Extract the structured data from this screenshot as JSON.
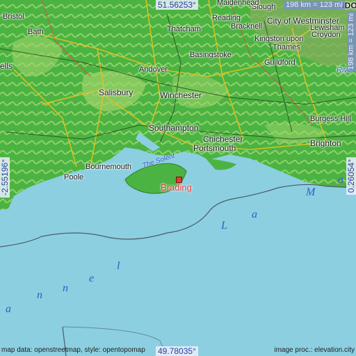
{
  "map": {
    "highlight_place": "Brading",
    "colors": {
      "sea": "#8ccfe0",
      "land_low": "#3fae3a",
      "land_high": "#9fd36a",
      "highlight": "#e23b3b",
      "coord_text": "#2b3f9a"
    },
    "places": {
      "bath": "Bath",
      "bristol": "Bristol",
      "ells": "ells",
      "salisbury": "Salisbury",
      "andover": "Andover",
      "winchester": "Winchester",
      "southampton": "Southampton",
      "bournemouth": "Bournemouth",
      "poole": "Poole",
      "portsmouth": "Portsmouth",
      "chichester": "Chichester",
      "brighton": "Brighton",
      "burgess_hill": "Burgess Hill",
      "guildford": "Guildford",
      "basingstoke": "Basingstoke",
      "reading": "Reading",
      "thatcham": "Thatcham",
      "bracknell": "Bracknell",
      "slough": "Slough",
      "maidenhead": "Maidenhead",
      "city_of_westminster": "City of Westminster",
      "lewisham": "Lewisham",
      "croydon": "Croydon",
      "kingston": "Kingston upon",
      "thames": "Thames",
      "rive": "Rive",
      "ndon": "NDON"
    },
    "water": {
      "the_solent": "The Solent",
      "channel_letters": [
        "a",
        "n",
        "n",
        "e",
        "l",
        "L",
        "a",
        "M",
        "a"
      ]
    },
    "coordinates": {
      "top_lat": "51.56253°",
      "bottom_lat": "49.78035°",
      "left_lon": "-2.55196°",
      "right_lon": "0.26054°"
    },
    "scale": {
      "top": "198 km = 123 mi",
      "right": "198 km = 123 mi"
    },
    "credits": {
      "left": "map data: openstreetmap, style: opentopomap",
      "right": "image proc.: elevation.city"
    }
  }
}
